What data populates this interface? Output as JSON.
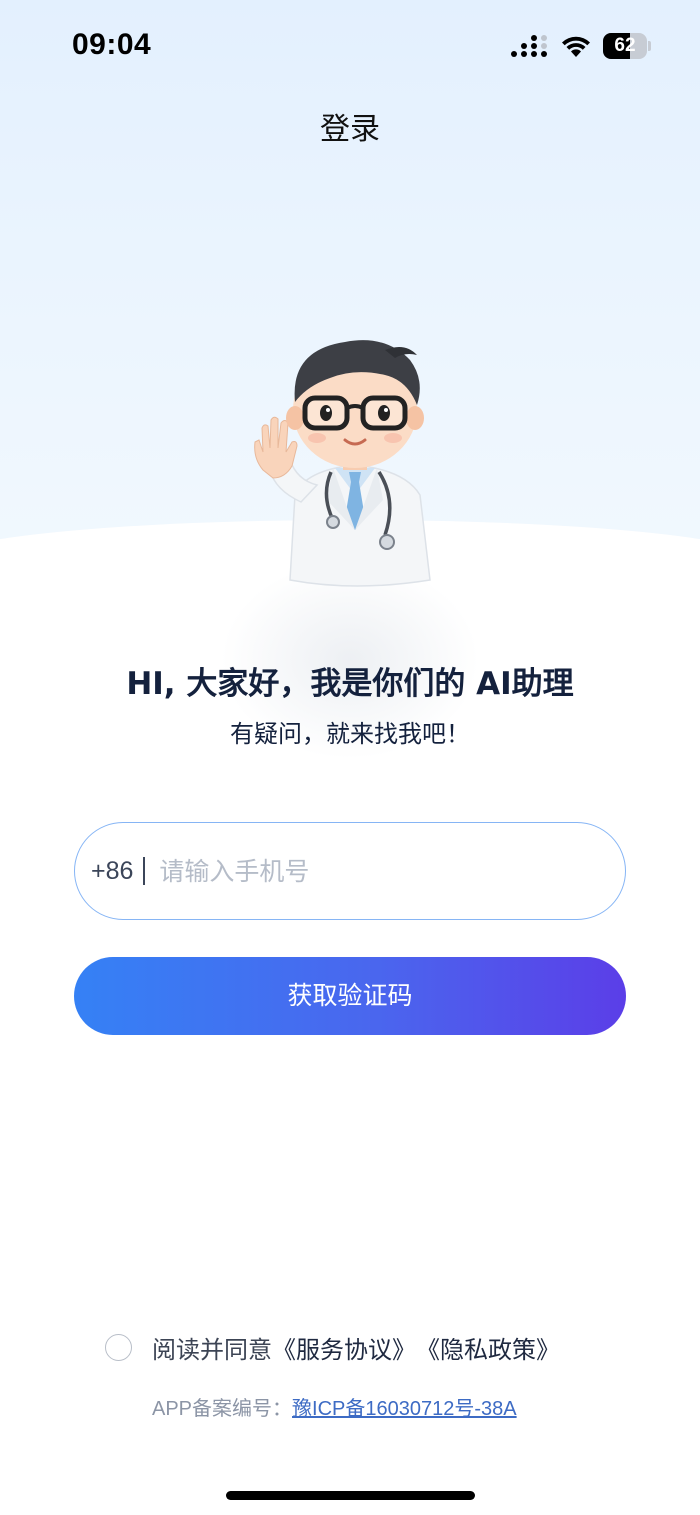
{
  "status_bar": {
    "time": "09:04",
    "battery_level": "62",
    "battery_fraction": 0.62,
    "icons": [
      "cellular-signal-icon",
      "wifi-icon",
      "battery-icon"
    ]
  },
  "nav": {
    "title": "登录"
  },
  "hero": {
    "mascot": "doctor-mascot-waving",
    "greeting": "HI, 大家好，我是你们的 AI助理",
    "subgreeting": "有疑问，就来找我吧！"
  },
  "login_form": {
    "country_code": "+86",
    "phone_placeholder": "请输入手机号",
    "phone_value": "",
    "submit_label": "获取验证码"
  },
  "agreement": {
    "checked": false,
    "prefix": "阅读并同意",
    "service_link": "《服务协议》",
    "privacy_link": "《隐私政策》",
    "icp_label": "APP备案编号：",
    "icp_number": "豫ICP备16030712号-38A"
  },
  "colors": {
    "accent_start": "#3581f5",
    "accent_end": "#5b3ee8",
    "input_border": "#86b5f5",
    "heading": "#14213d",
    "link": "#3d6bc4"
  }
}
